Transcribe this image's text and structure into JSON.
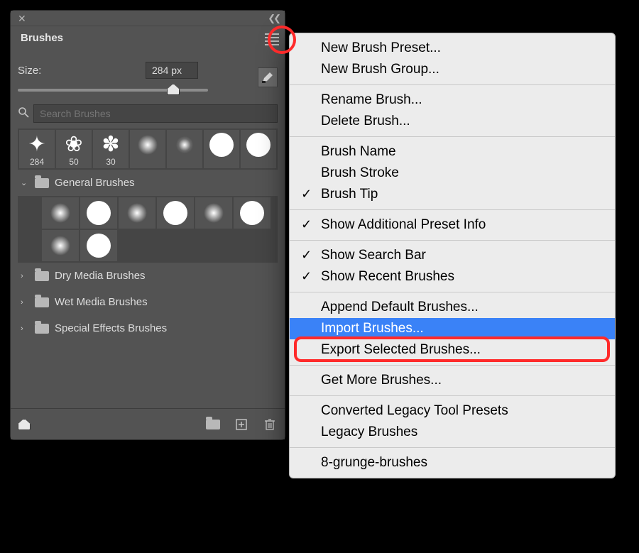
{
  "panel": {
    "tab": "Brushes",
    "size_label": "Size:",
    "size_value": "284 px",
    "search_placeholder": "Search Brushes",
    "recent": [
      {
        "label": "284",
        "kind": "splat"
      },
      {
        "label": "50",
        "kind": "splat2"
      },
      {
        "label": "30",
        "kind": "splat3"
      },
      {
        "label": "",
        "kind": "soft"
      },
      {
        "label": "",
        "kind": "med"
      },
      {
        "label": "",
        "kind": "hard"
      },
      {
        "label": "",
        "kind": "hard"
      }
    ],
    "group_open_label": "General Brushes",
    "general": [
      "soft",
      "hard",
      "soft",
      "hard",
      "soft",
      "hard",
      "soft",
      "hard"
    ],
    "folders": [
      "Dry Media Brushes",
      "Wet Media Brushes",
      "Special Effects Brushes"
    ]
  },
  "menu": {
    "items": [
      {
        "label": "New Brush Preset..."
      },
      {
        "label": "New Brush Group..."
      },
      {
        "sep": true
      },
      {
        "label": "Rename Brush..."
      },
      {
        "label": "Delete Brush..."
      },
      {
        "sep": true
      },
      {
        "label": "Brush Name"
      },
      {
        "label": "Brush Stroke"
      },
      {
        "label": "Brush Tip",
        "checked": true
      },
      {
        "sep": true
      },
      {
        "label": "Show Additional Preset Info",
        "checked": true
      },
      {
        "sep": true
      },
      {
        "label": "Show Search Bar",
        "checked": true
      },
      {
        "label": "Show Recent Brushes",
        "checked": true
      },
      {
        "sep": true
      },
      {
        "label": "Append Default Brushes..."
      },
      {
        "label": "Import Brushes...",
        "selected": true
      },
      {
        "label": "Export Selected Brushes..."
      },
      {
        "sep": true
      },
      {
        "label": "Get More Brushes..."
      },
      {
        "sep": true
      },
      {
        "label": "Converted Legacy Tool Presets"
      },
      {
        "label": "Legacy Brushes"
      },
      {
        "sep": true
      },
      {
        "label": "8-grunge-brushes"
      }
    ]
  }
}
